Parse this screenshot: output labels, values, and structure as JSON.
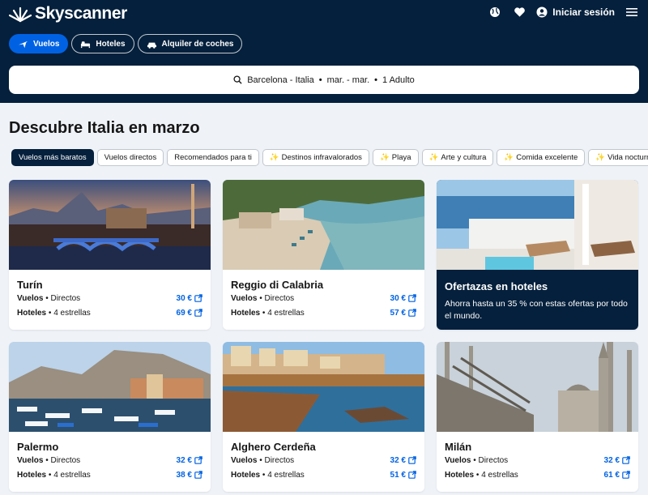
{
  "header": {
    "brand": "Skyscanner",
    "signin_label": "Iniciar sesión",
    "tabs": [
      {
        "label": "Vuelos",
        "icon": "plane-icon",
        "active": true
      },
      {
        "label": "Hoteles",
        "icon": "bed-icon",
        "active": false
      },
      {
        "label": "Alquiler de coches",
        "icon": "car-icon",
        "active": false
      }
    ]
  },
  "search": {
    "destination": "Barcelona - Italia",
    "dates": "mar. - mar.",
    "travellers": "1 Adulto",
    "separator": "•"
  },
  "main": {
    "title": "Descubre Italia en marzo",
    "filters": [
      {
        "label": "Vuelos más baratos",
        "active": true,
        "sparkle": false
      },
      {
        "label": "Vuelos directos",
        "active": false,
        "sparkle": false
      },
      {
        "label": "Recomendados para ti",
        "active": false,
        "sparkle": false
      },
      {
        "label": "Destinos infravalorados",
        "active": false,
        "sparkle": true
      },
      {
        "label": "Playa",
        "active": false,
        "sparkle": true
      },
      {
        "label": "Arte y cultura",
        "active": false,
        "sparkle": true
      },
      {
        "label": "Comida excelente",
        "active": false,
        "sparkle": true
      },
      {
        "label": "Vida nocturna y",
        "active": false,
        "sparkle": true
      }
    ],
    "cards": [
      {
        "name": "Turín",
        "flights_label": "Vuelos",
        "flights_detail": "Directos",
        "flights_price": "30 €",
        "hotels_label": "Hoteles",
        "hotels_detail": "4 estrellas",
        "hotels_price": "69 €"
      },
      {
        "name": "Reggio di Calabria",
        "flights_label": "Vuelos",
        "flights_detail": "Directos",
        "flights_price": "30 €",
        "hotels_label": "Hoteles",
        "hotels_detail": "4 estrellas",
        "hotels_price": "57 €"
      },
      {
        "name": "Palermo",
        "flights_label": "Vuelos",
        "flights_detail": "Directos",
        "flights_price": "32 €",
        "hotels_label": "Hoteles",
        "hotels_detail": "4 estrellas",
        "hotels_price": "38 €"
      },
      {
        "name": "Alghero Cerdeña",
        "flights_label": "Vuelos",
        "flights_detail": "Directos",
        "flights_price": "32 €",
        "hotels_label": "Hoteles",
        "hotels_detail": "4 estrellas",
        "hotels_price": "51 €"
      },
      {
        "name": "Milán",
        "flights_label": "Vuelos",
        "flights_detail": "Directos",
        "flights_price": "32 €",
        "hotels_label": "Hoteles",
        "hotels_detail": "4 estrellas",
        "hotels_price": "61 €"
      }
    ],
    "promo": {
      "title": "Ofertazas en hoteles",
      "text": "Ahorra hasta un 35 % con estas ofertas por todo el mundo."
    }
  },
  "colors": {
    "navy": "#05203c",
    "accent_blue": "#0062e3",
    "background": "#eff3f8"
  }
}
